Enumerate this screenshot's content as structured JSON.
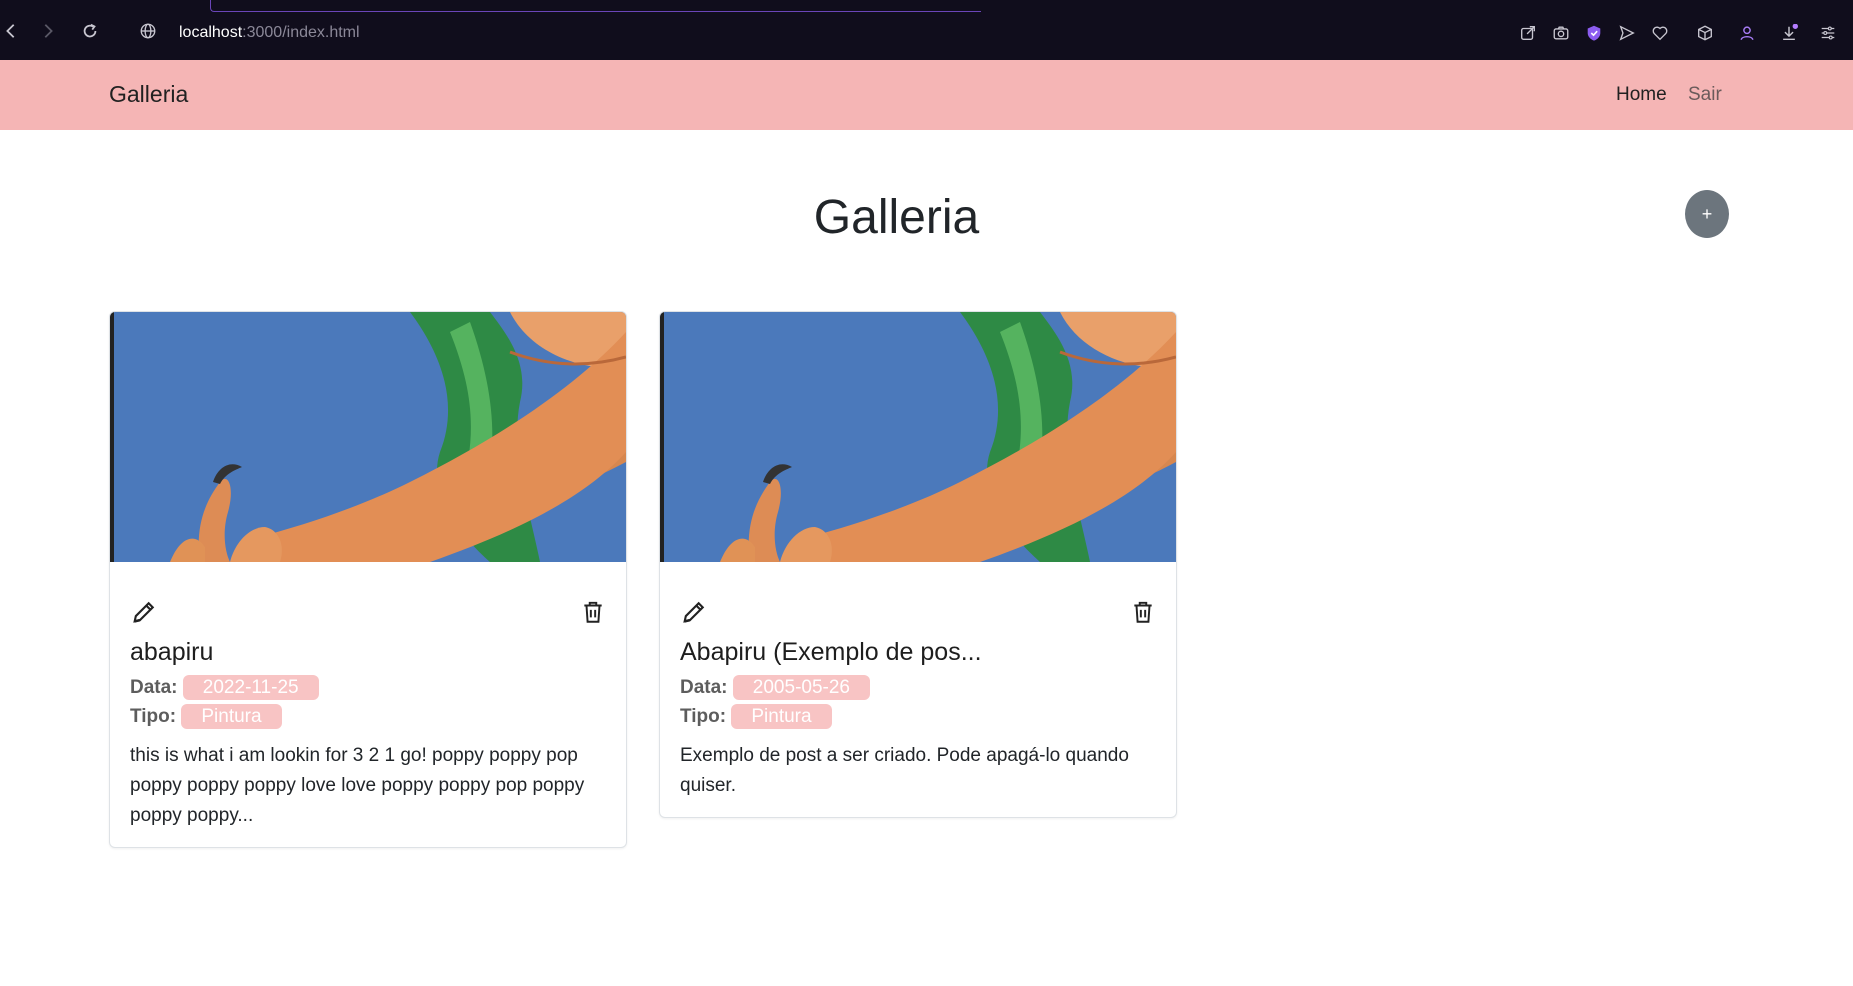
{
  "browser": {
    "url_host": "localhost",
    "url_path": ":3000/index.html"
  },
  "navbar": {
    "brand": "Galleria",
    "links": [
      {
        "label": "Home"
      },
      {
        "label": "Sair"
      }
    ]
  },
  "main": {
    "title": "Galleria",
    "add_button_label": "+"
  },
  "cards": [
    {
      "title": "abapiru",
      "data_label": "Data:",
      "data_value": "2022-11-25",
      "tipo_label": "Tipo:",
      "tipo_value": "Pintura",
      "description": "this is what i am lookin for 3 2 1 go! poppy poppy pop poppy poppy poppy love love poppy poppy pop poppy poppy poppy..."
    },
    {
      "title": "Abapiru (Exemplo de pos...",
      "data_label": "Data:",
      "data_value": "2005-05-26",
      "tipo_label": "Tipo:",
      "tipo_value": "Pintura",
      "description": "Exemplo de post a ser criado. Pode apagá-lo quando quiser."
    }
  ],
  "colors": {
    "navbar_bg": "#f5b5b5",
    "pill_bg": "#f8c4c4",
    "add_button_bg": "#6c757d",
    "browser_bg": "#100d1c"
  }
}
